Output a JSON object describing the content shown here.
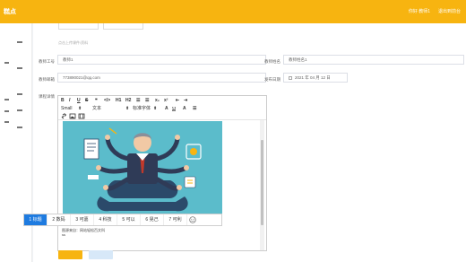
{
  "header": {
    "brand": "糕点",
    "user_label": "你好 教师1",
    "logout_label": "退出到前台"
  },
  "form": {
    "upload_hint": "点击上传课件/资料",
    "fields": {
      "teacher_id": {
        "label": "教师工号",
        "value": "教师1"
      },
      "teacher_name": {
        "label": "教师姓名",
        "value": "教师姓名1"
      },
      "email": {
        "label": "教师邮箱",
        "value": "773890021@qq.com"
      },
      "date": {
        "label": "发布日期",
        "value": "2021 年 04 月 12 日"
      },
      "detail": {
        "label": "课程详情"
      }
    }
  },
  "editor": {
    "toolbar_row1": [
      "B",
      "I",
      "U",
      "S",
      "❝",
      "</>",
      "H1",
      "H2",
      "☰",
      "☰",
      "x₂",
      "x²",
      "⇤",
      "⇥"
    ],
    "toolbar_row2": {
      "size": "Small",
      "font_label": "文本",
      "header_label": "标准字体"
    },
    "caption": "图源来自：网站轻松百文科",
    "caption_line2": "ss"
  },
  "ime": {
    "items": [
      "1 标题",
      "2 数码",
      "3 可嘉",
      "4 科技",
      "5 可以",
      "6 晃己",
      "7 可利"
    ]
  },
  "colors": {
    "accent": "#f7b410",
    "ime_active": "#1e7be0",
    "illustration_bg": "#5bbccb"
  },
  "icons": {
    "emoji": "emoji-icon",
    "calendar": "calendar-icon",
    "image": "image-icon",
    "link": "link-icon",
    "video": "video-icon"
  }
}
